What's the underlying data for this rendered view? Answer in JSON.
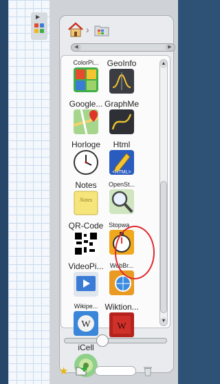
{
  "sidebar": {
    "collapse_arrow": "▶",
    "icon": "library-grid-icon",
    "icon_colors": [
      "#e24b2a",
      "#3b7bd6",
      "#f2b51f",
      "#3bb046"
    ]
  },
  "library": {
    "nav": {
      "home_icon": "home-icon",
      "separator": "›",
      "folder_icon": "applications-folder-icon"
    },
    "items": [
      {
        "label": "ColorPi...",
        "icon": "color-picker-icon",
        "small": true
      },
      {
        "label": "GeoInfo",
        "icon": "geoinfo-icon",
        "small": false
      },
      {
        "label": "Google...",
        "icon": "google-maps-icon",
        "small": false
      },
      {
        "label": "GraphMe",
        "icon": "graphme-icon",
        "small": false
      },
      {
        "label": "Horloge",
        "icon": "clock-icon",
        "small": false
      },
      {
        "label": "Html",
        "icon": "html-icon",
        "small": false
      },
      {
        "label": "Notes",
        "icon": "notes-icon",
        "small": false
      },
      {
        "label": "OpenSt...",
        "icon": "openstreetmap-icon",
        "small": true
      },
      {
        "label": "QR-Code",
        "icon": "qr-code-icon",
        "small": false
      },
      {
        "label": "Stopwa...",
        "icon": "stopwatch-icon",
        "small": true
      },
      {
        "label": "VideoPi...",
        "icon": "video-picker-icon",
        "small": false
      },
      {
        "label": "WebBr...",
        "icon": "web-browser-icon",
        "small": true
      },
      {
        "label": "Wikipe...",
        "icon": "wikipedia-icon",
        "small": true
      },
      {
        "label": "Wiktion...",
        "icon": "wiktionary-icon",
        "small": false
      },
      {
        "label": "iCell",
        "icon": "icell-icon",
        "small": false
      }
    ],
    "selected_item": "Stopwa...",
    "highlight_color": "#e0282a",
    "zoom_level": 0.3
  },
  "bottom_bar": {
    "favorite_icon": "star-icon",
    "new_folder_icon": "add-folder-icon",
    "search_value": "",
    "delete_icon": "trash-icon"
  }
}
